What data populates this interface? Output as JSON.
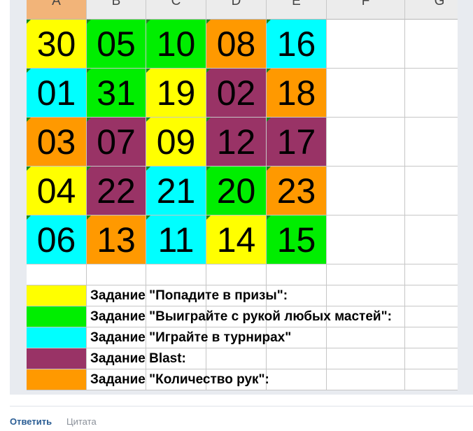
{
  "colors": {
    "yellow": "#ffff00",
    "green": "#00ee00",
    "cyan": "#00ffff",
    "purple": "#993366",
    "orange": "#ff9900"
  },
  "column_headers": [
    "A",
    "B",
    "C",
    "D",
    "E",
    "F",
    "G"
  ],
  "grid": [
    [
      {
        "value": "30",
        "color": "yellow"
      },
      {
        "value": "05",
        "color": "green"
      },
      {
        "value": "10",
        "color": "green"
      },
      {
        "value": "08",
        "color": "orange"
      },
      {
        "value": "16",
        "color": "cyan"
      }
    ],
    [
      {
        "value": "01",
        "color": "cyan"
      },
      {
        "value": "31",
        "color": "green"
      },
      {
        "value": "19",
        "color": "yellow"
      },
      {
        "value": "02",
        "color": "purple"
      },
      {
        "value": "18",
        "color": "orange"
      }
    ],
    [
      {
        "value": "03",
        "color": "orange"
      },
      {
        "value": "07",
        "color": "purple"
      },
      {
        "value": "09",
        "color": "yellow"
      },
      {
        "value": "12",
        "color": "purple"
      },
      {
        "value": "17",
        "color": "purple"
      }
    ],
    [
      {
        "value": "04",
        "color": "yellow"
      },
      {
        "value": "22",
        "color": "purple"
      },
      {
        "value": "21",
        "color": "cyan"
      },
      {
        "value": "20",
        "color": "green"
      },
      {
        "value": "23",
        "color": "orange"
      }
    ],
    [
      {
        "value": "06",
        "color": "cyan"
      },
      {
        "value": "13",
        "color": "orange"
      },
      {
        "value": "11",
        "color": "cyan"
      },
      {
        "value": "14",
        "color": "yellow"
      },
      {
        "value": "15",
        "color": "green"
      }
    ]
  ],
  "legend": [
    {
      "color": "yellow",
      "label": "Задание \"Попадите в призы\":"
    },
    {
      "color": "green",
      "label": "Задание \"Выиграйте с рукой любых мастей\":"
    },
    {
      "color": "cyan",
      "label": "Задание \"Играйте в турнирах\""
    },
    {
      "color": "purple",
      "label": "Задание Blast:"
    },
    {
      "color": "orange",
      "label": "Задание \"Количество рук\":"
    }
  ],
  "footer": {
    "reply_label": "Ответить",
    "quote_label": "Цитата"
  }
}
